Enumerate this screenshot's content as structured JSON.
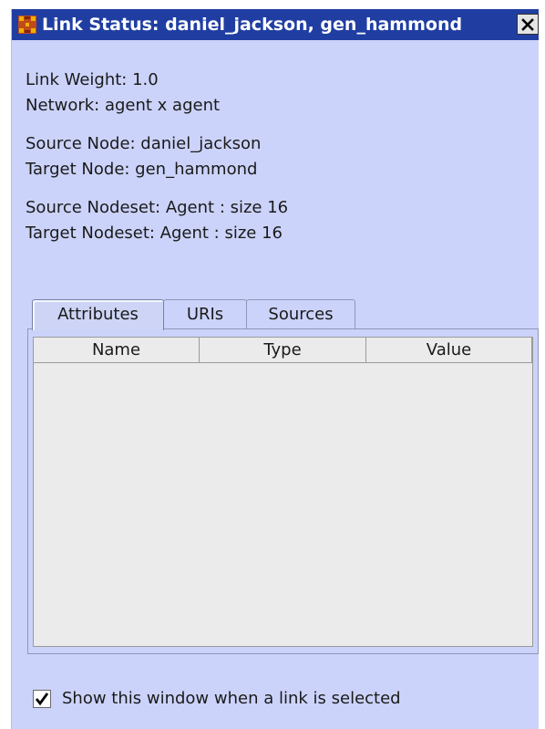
{
  "window": {
    "title": "Link Status: daniel_jackson, gen_hammond",
    "icon": "grid-icon",
    "close_icon": "close-icon",
    "background": "#ccd3fa",
    "titlebar_color": "#203ea2"
  },
  "info": {
    "link_weight": "Link Weight: 1.0",
    "network": "Network: agent x agent",
    "source_node": "Source Node: daniel_jackson",
    "target_node": "Target Node: gen_hammond",
    "source_nodeset": "Source Nodeset: Agent : size 16",
    "target_nodeset": "Target Nodeset: Agent : size 16"
  },
  "tabs": [
    {
      "label": "Attributes",
      "active": true
    },
    {
      "label": "URIs",
      "active": false
    },
    {
      "label": "Sources",
      "active": false
    }
  ],
  "table": {
    "columns": [
      "Name",
      "Type",
      "Value"
    ],
    "rows": []
  },
  "footer": {
    "checkbox_label": "Show this window when a link is selected",
    "checkbox_checked": true
  }
}
